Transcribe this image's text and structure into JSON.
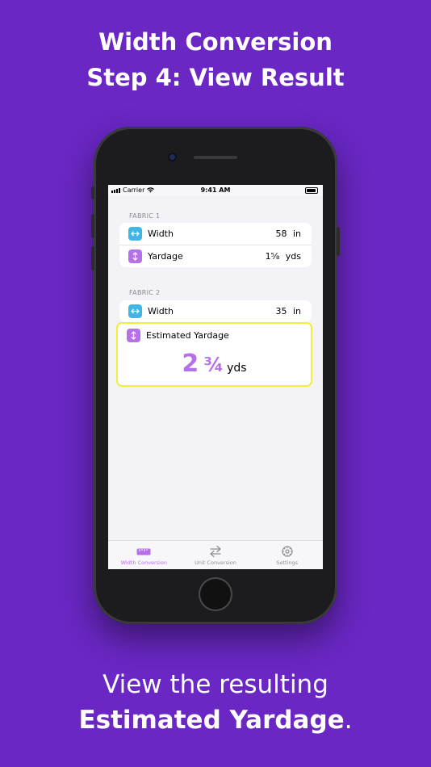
{
  "headline": {
    "line1": "Width Conversion",
    "line2": "Step 4: View Result"
  },
  "statusbar": {
    "carrier": "Carrier",
    "time": "9:41 AM"
  },
  "fabric1": {
    "label": "FABRIC 1",
    "width_label": "Width",
    "width_value": "58",
    "width_unit": "in",
    "yardage_label": "Yardage",
    "yardage_value": "1⅝",
    "yardage_unit": "yds"
  },
  "fabric2": {
    "label": "FABRIC 2",
    "width_label": "Width",
    "width_value": "35",
    "width_unit": "in",
    "estimated_label": "Estimated Yardage",
    "result_whole": "2",
    "result_fraction": "¾",
    "result_unit": "yds"
  },
  "tabs": [
    {
      "label": "Width Conversion",
      "icon": "ruler-icon",
      "active": true
    },
    {
      "label": "Unit Conversion",
      "icon": "swap-arrows-icon",
      "active": false
    },
    {
      "label": "Settings",
      "icon": "gear-icon",
      "active": false
    }
  ],
  "caption": {
    "line1": "View the resulting",
    "line2_bold": "Estimated Yardage",
    "line2_end": "."
  },
  "colors": {
    "background": "#6a27c4",
    "accent_purple": "#b670e8",
    "accent_blue": "#3fb7e6",
    "highlight": "#f2ee3a"
  }
}
